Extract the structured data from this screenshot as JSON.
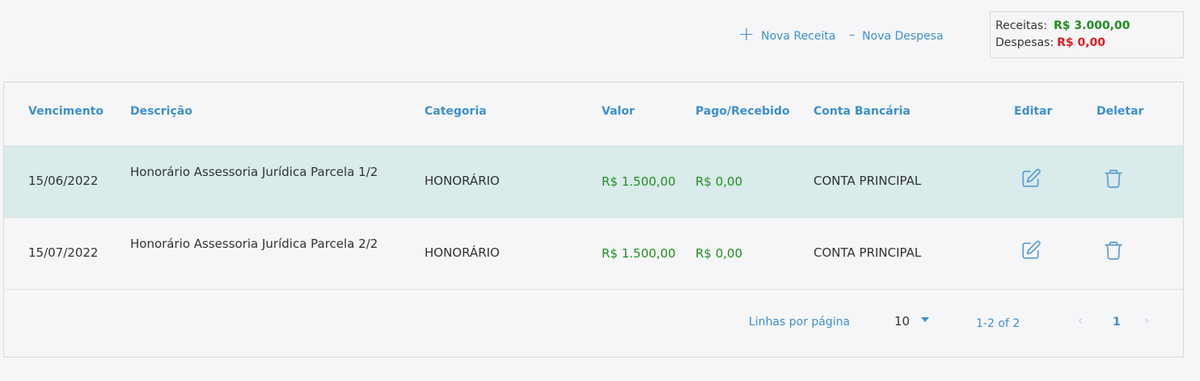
{
  "actions": {
    "new_income": {
      "icon": "+",
      "label": "Nova Receita"
    },
    "new_expense": {
      "icon": "-",
      "label": "Nova Despesa"
    }
  },
  "summary": {
    "income_label": "Receitas:",
    "income_value": "R$ 3.000,00",
    "expense_label": "Despesas:",
    "expense_value": "R$ 0,00"
  },
  "table": {
    "headers": [
      "Vencimento",
      "Descrição",
      "Categoria",
      "Valor",
      "Pago/Recebido",
      "Conta Bancária",
      "Editar",
      "Deletar"
    ],
    "rows": [
      {
        "due": "15/06/2022",
        "description": "Honorário Assessoria Jurídica Parcela 1/2",
        "category": "HONORÁRIO",
        "value": "R$ 1.500,00",
        "paid": "R$ 0,00",
        "account": "CONTA PRINCIPAL"
      },
      {
        "due": "15/07/2022",
        "description": "Honorário Assessoria Jurídica Parcela 2/2",
        "category": "HONORÁRIO",
        "value": "R$ 1.500,00",
        "paid": "R$ 0,00",
        "account": "CONTA PRINCIPAL"
      }
    ]
  },
  "pagination": {
    "rows_per_page_label": "Linhas por página",
    "rows_per_page_value": "10",
    "range": "1-2 of 2",
    "current_page": "1",
    "prev_icon": "‹",
    "next_icon": "›"
  },
  "colors": {
    "accent": "#3d8fcf",
    "positive": "#1e8f1e",
    "negative": "#e02020",
    "highlight_row": "#d9ebea"
  }
}
